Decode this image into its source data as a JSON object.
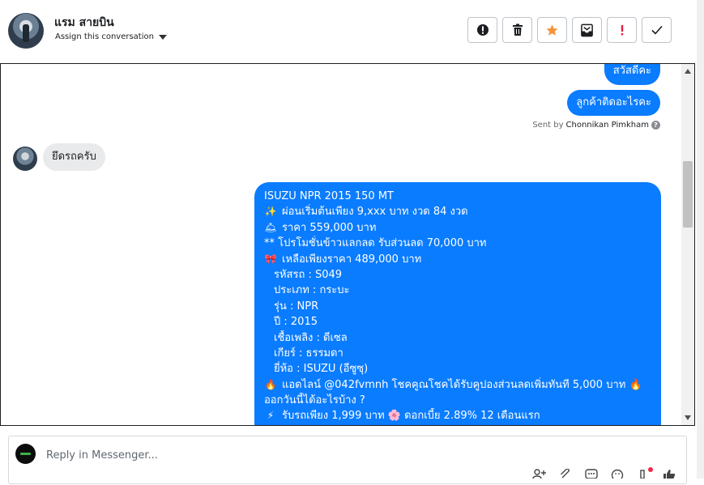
{
  "header": {
    "contact_name": "แรม สายบิน",
    "assign_label": "Assign this conversation",
    "actions": [
      {
        "name": "mark-spam-button",
        "icon": "alert-circle-icon"
      },
      {
        "name": "delete-button",
        "icon": "trash-icon"
      },
      {
        "name": "star-button",
        "icon": "star-icon"
      },
      {
        "name": "move-to-inbox-button",
        "icon": "inbox-icon"
      },
      {
        "name": "follow-up-button",
        "icon": "exclamation-icon"
      },
      {
        "name": "mark-done-button",
        "icon": "check-icon"
      }
    ],
    "colors": {
      "star": "#f7923a",
      "alert": "#e41e3f"
    }
  },
  "messages": {
    "out_1": "สวัสดีคะ",
    "out_2": "ลูกค้าติดอะไรคะ",
    "sent_by_prefix": "Sent by",
    "sent_by_agent": "Chonnikan Pimkham",
    "in_1": "ยึดรถครับ",
    "listing_lines": [
      {
        "emoji": "",
        "text": "ISUZU NPR 2015 150 MT"
      },
      {
        "emoji": "✨",
        "text": "ผ่อนเริ่มต้นเพียง 9,xxx บาท งวด 84 งวด"
      },
      {
        "emoji": "🛎",
        "text": "ราคา 559,000 บาท"
      },
      {
        "emoji": "",
        "text": "** โปรโมชั่นข้าวแลกลด รับส่วนลด 70,000 บาท"
      },
      {
        "emoji": "🎀",
        "text": "เหลือเพียงราคา 489,000 บาท"
      },
      {
        "emoji": "",
        "text": "รหัสรถ : S049",
        "indent": true
      },
      {
        "emoji": "",
        "text": "ประเภท : กระบะ",
        "indent": true
      },
      {
        "emoji": "",
        "text": "รุ่น : NPR",
        "indent": true
      },
      {
        "emoji": "",
        "text": "ปี : 2015",
        "indent": true
      },
      {
        "emoji": "",
        "text": "เชื้อเพลิง : ดีเซล",
        "indent": true
      },
      {
        "emoji": "",
        "text": "เกียร์ : ธรรมดา",
        "indent": true
      },
      {
        "emoji": "",
        "text": "ยี่ห้อ : ISUZU (อีซูซุ)",
        "indent": true
      },
      {
        "emoji": "🔥",
        "text": "แอดไลน์ @042fvmnh โชคคูณโชคได้รับคูปองส่วนลดเพิ่มทันที 5,000 บาท 🔥"
      },
      {
        "emoji": "",
        "text": "ออกวันนี้ได้อะไรบ้าง ?"
      },
      {
        "emoji": "⚡",
        "text": "รับรถเพียง 1,999 บาท 🌸 ดอกเบี้ย 2.89% 12 เดือนแรก"
      }
    ]
  },
  "reply": {
    "placeholder": "Reply in Messenger...",
    "tools": [
      "add-person-icon",
      "attachment-icon",
      "saved-reply-icon",
      "emoji-icon",
      "notification-icon",
      "like-icon"
    ],
    "notification_dot_color": "#f02849"
  }
}
